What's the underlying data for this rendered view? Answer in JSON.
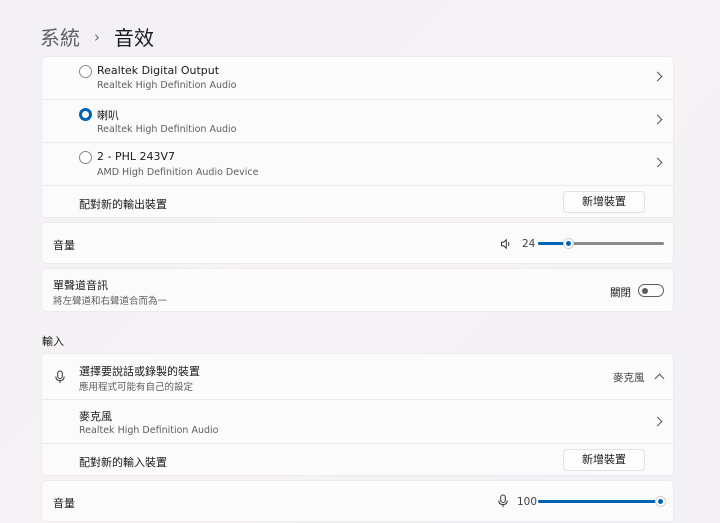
{
  "breadcrumb": {
    "parent": "系統",
    "separator": "›",
    "current": "音效"
  },
  "output": {
    "devices": [
      {
        "name": "Realtek Digital Output",
        "detail": "Realtek High Definition Audio",
        "selected": false
      },
      {
        "name": "喇叭",
        "detail": "Realtek High Definition Audio",
        "selected": true
      },
      {
        "name": "2 - PHL 243V7",
        "detail": "AMD High Definition Audio Device",
        "selected": false
      }
    ],
    "pair_label": "配對新的輸出裝置",
    "add_button": "新增裝置",
    "volume_label": "音量",
    "volume_value": "24",
    "volume_fraction": 0.24,
    "mono_title": "單聲道音訊",
    "mono_desc": "將左聲道和右聲道合而為一",
    "mono_state": "關閉"
  },
  "input": {
    "section_label": "輸入",
    "chooser_title": "選擇要說話或錄製的裝置",
    "chooser_desc": "應用程式可能有自己的設定",
    "chooser_value": "麥克風",
    "device_name": "麥克風",
    "device_detail": "Realtek High Definition Audio",
    "pair_label": "配對新的輸入裝置",
    "add_button": "新增裝置",
    "volume_label": "音量",
    "volume_value": "100",
    "volume_fraction": 1.0
  },
  "colors": {
    "accent": "#0063b1",
    "background": "#f4f1f6"
  }
}
